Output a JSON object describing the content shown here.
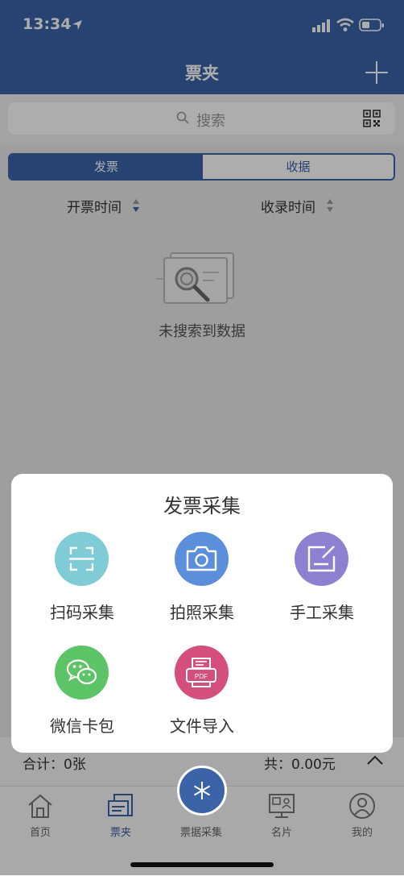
{
  "status": {
    "time": "13:34"
  },
  "nav": {
    "title": "票夹"
  },
  "search": {
    "placeholder": "搜索"
  },
  "tabs": {
    "left": "发票",
    "right": "收据"
  },
  "sort": {
    "invoice_time": "开票时间",
    "record_time": "收录时间"
  },
  "empty": {
    "text": "未搜索到数据"
  },
  "summary": {
    "total": "合计：0张",
    "sum": "共：0.00元"
  },
  "tabbar": {
    "home": "首页",
    "folder": "票夹",
    "collect": "票据采集",
    "card": "名片",
    "mine": "我的"
  },
  "sheet": {
    "title": "发票采集",
    "actions": [
      {
        "label": "扫码采集",
        "icon": "scan-icon",
        "color": "#7fcbd6"
      },
      {
        "label": "拍照采集",
        "icon": "camera-icon",
        "color": "#5b8fdc"
      },
      {
        "label": "手工采集",
        "icon": "edit-icon",
        "color": "#8f7fd1"
      },
      {
        "label": "微信卡包",
        "icon": "wechat-icon",
        "color": "#5cc466"
      },
      {
        "label": "文件导入",
        "icon": "pdf-file-icon",
        "color": "#d44f79"
      }
    ]
  },
  "colors": {
    "primary": "#3a63a8"
  }
}
